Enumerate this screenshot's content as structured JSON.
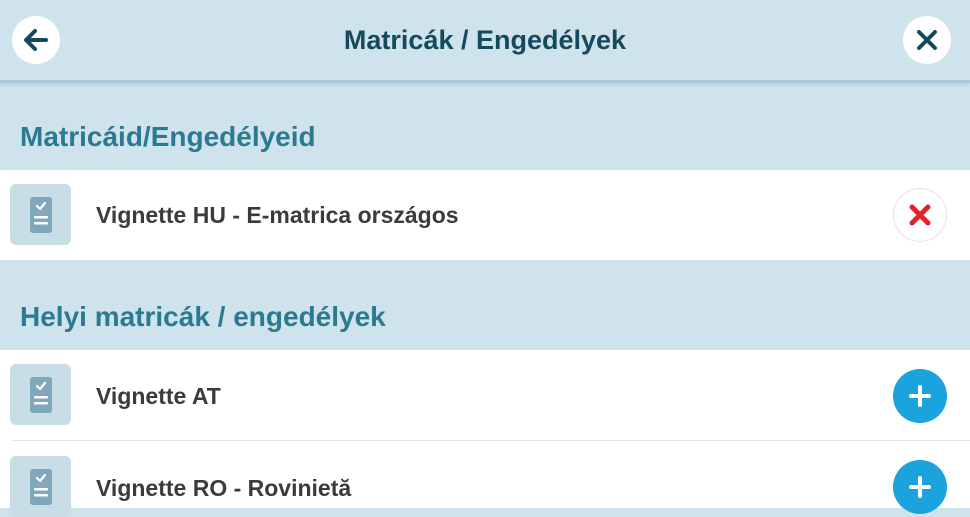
{
  "header": {
    "title": "Matricák / Engedélyek",
    "back_icon": "arrow-left-icon",
    "close_icon": "close-icon"
  },
  "my_vignettes": {
    "title": "Matricáid/Engedélyeid",
    "items": [
      {
        "label": "Vignette HU - E-matrica országos",
        "icon": "vignette-document-icon",
        "action": "remove"
      }
    ]
  },
  "local_vignettes": {
    "title": "Helyi matricák / engedélyek",
    "items": [
      {
        "label": "Vignette AT",
        "icon": "vignette-document-icon",
        "action": "add"
      },
      {
        "label": "Vignette RO - Rovinietă",
        "icon": "vignette-document-icon",
        "action": "add"
      }
    ]
  },
  "colors": {
    "background": "#cfe3ec",
    "title": "#14495e",
    "section_title": "#2c7a92",
    "add_button": "#1aa3dc",
    "remove_icon": "#e0242b"
  }
}
